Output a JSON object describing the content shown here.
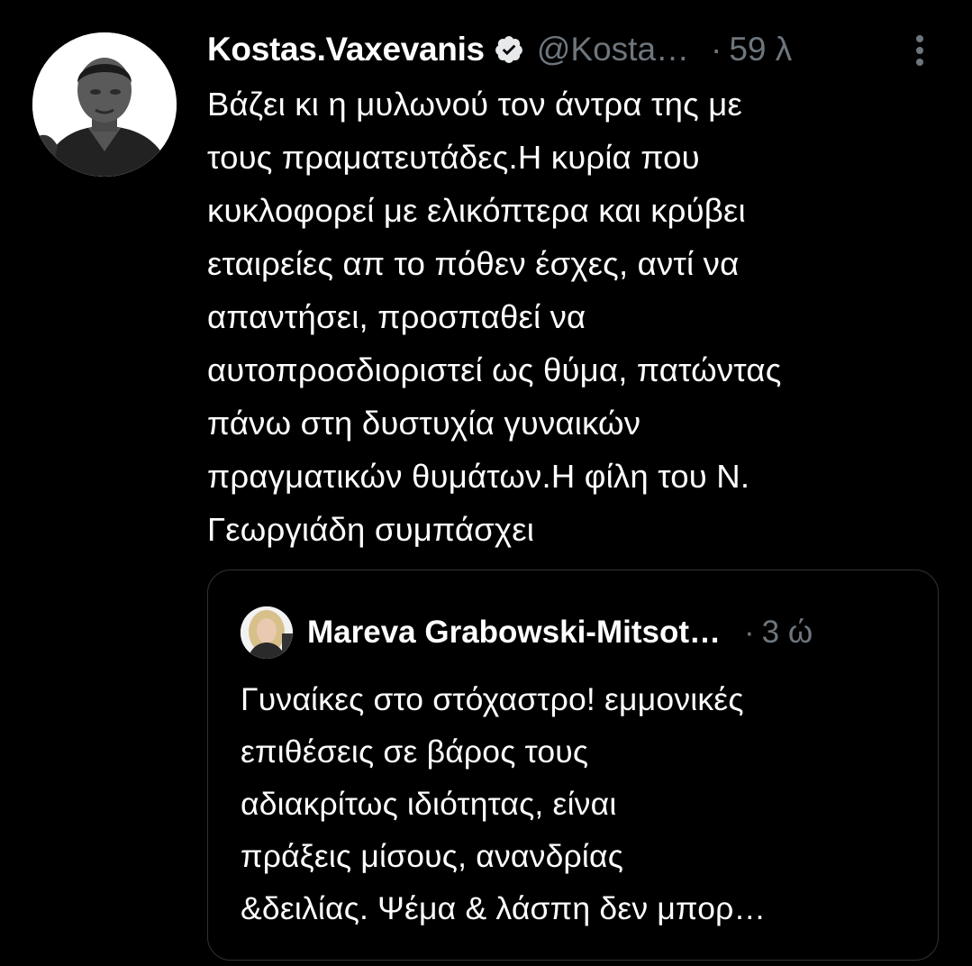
{
  "tweet": {
    "author": {
      "display_name": "Kostas.Vaxevanis",
      "handle": "@Kosta…",
      "verified": true,
      "avatar": "profile-photo"
    },
    "separator": "·",
    "time": "59 λ",
    "more_icon": "more-vertical-icon",
    "text": "Βάζει κι η μυλωνού τον άντρα της με\nτους πραματευτάδες.Η κυρία που\nκυκλοφορεί με ελικόπτερα και κρύβει\nεταιρείες απ το πόθεν έσχες, αντί να\nαπαντήσει, προσπαθεί να\nαυτοπροσδιοριστεί ως θύμα, πατώντας\nπάνω στη δυστυχία γυναικών\nπραγματικών θυμάτων.Η φίλη του Ν.\nΓεωργιάδη συμπάσχει"
  },
  "quote": {
    "author": {
      "display_name": "Mareva Grabowski-Mitsot…",
      "avatar": "profile-photo"
    },
    "separator": "·",
    "time": "3 ώ",
    "text": "Γυναίκες στο στόχαστρο! εμμονικές\nεπιθέσεις σε βάρος τους\nαδιακρίτως ιδιότητας, είναι\nπράξεις μίσους, ανανδρίας\n&δειλίας. Ψέμα & λάσπη δεν μπορ…"
  },
  "colors": {
    "background": "#000000",
    "text_primary": "#ffffff",
    "text_secondary": "#6e767d",
    "border": "#2f3336"
  }
}
